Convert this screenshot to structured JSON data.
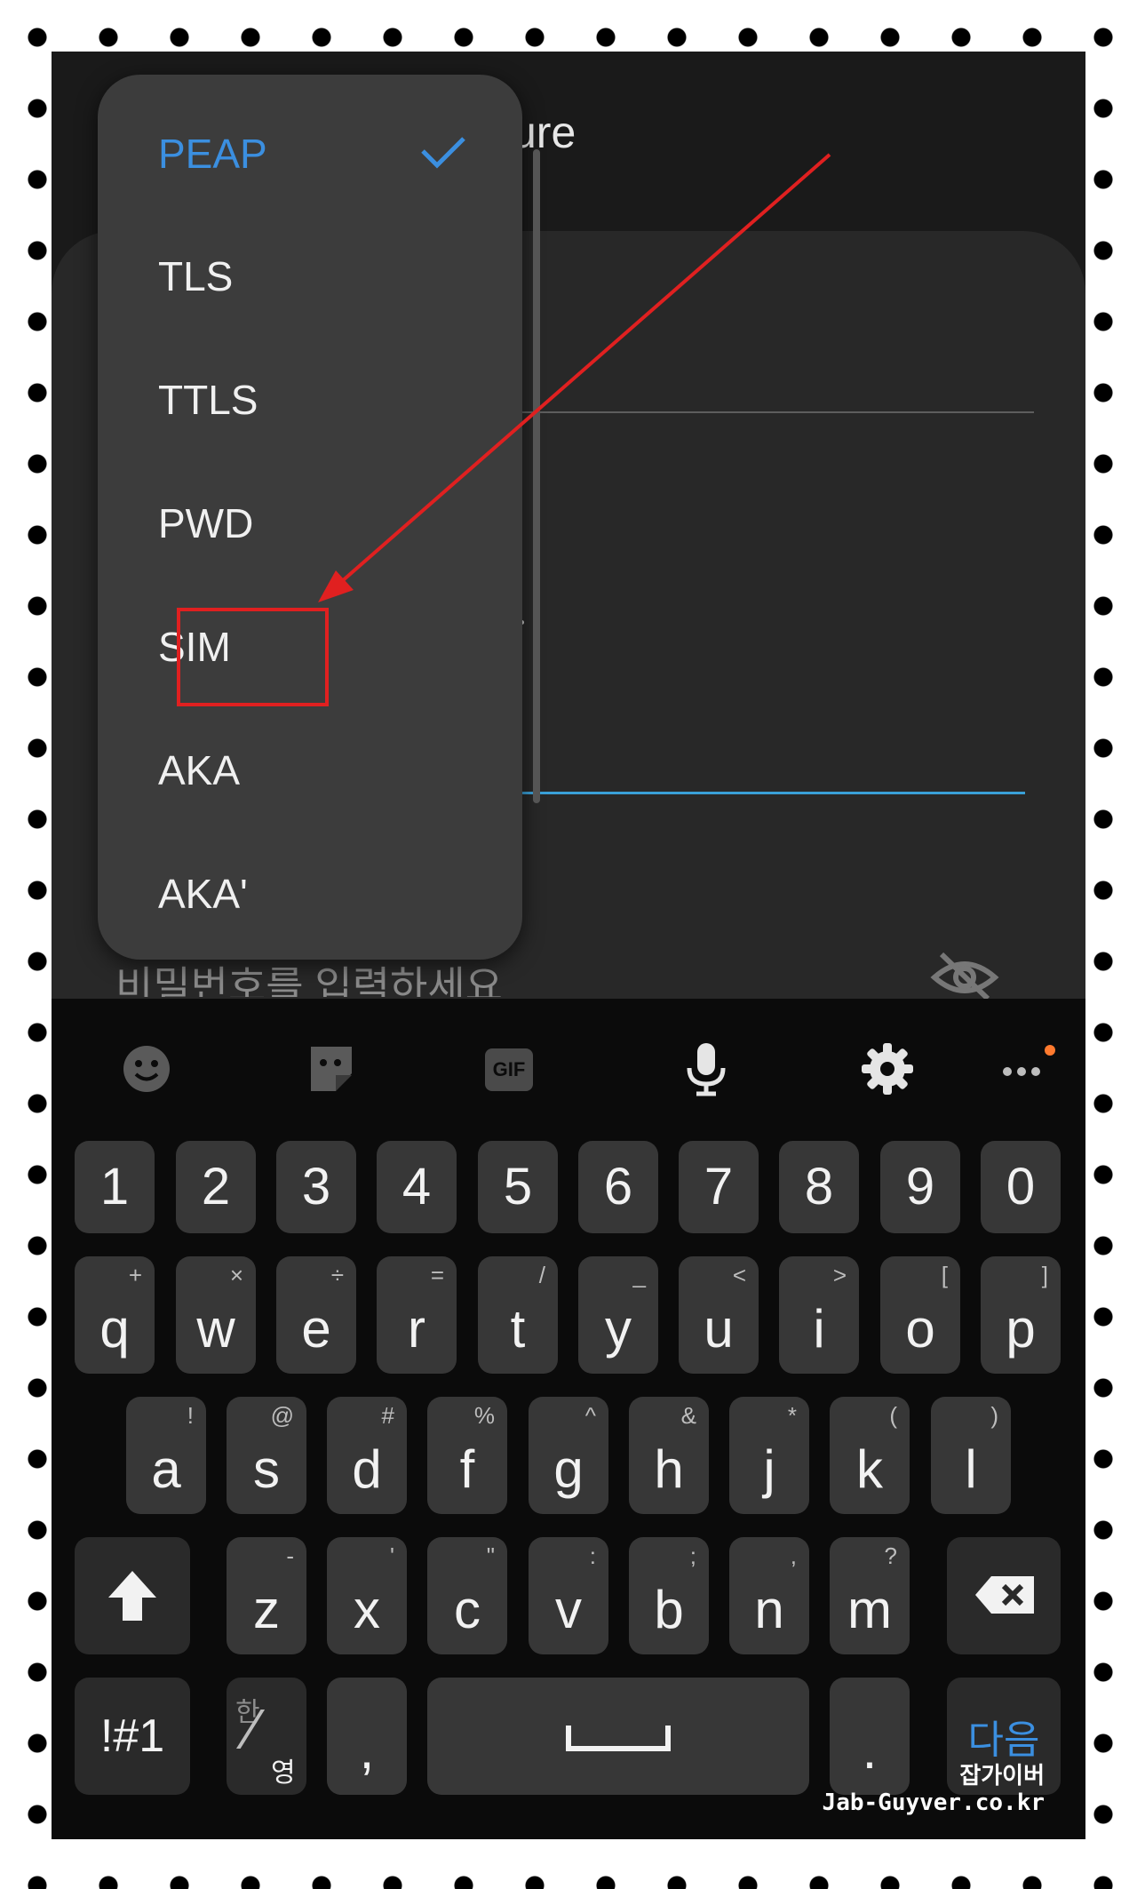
{
  "background": {
    "title_fragment": "ure",
    "password_placeholder": "비밀번호를 입력하세요"
  },
  "dropdown": {
    "items": [
      {
        "label": "PEAP",
        "selected": true
      },
      {
        "label": "TLS"
      },
      {
        "label": "TTLS"
      },
      {
        "label": "PWD"
      },
      {
        "label": "SIM",
        "highlighted": true
      },
      {
        "label": "AKA"
      },
      {
        "label": "AKA'"
      }
    ]
  },
  "keyboard": {
    "toolbar": [
      "emoji-icon",
      "sticker-icon",
      "gif-icon",
      "microphone-icon",
      "settings-icon",
      "more-icon"
    ],
    "gif_label": "GIF",
    "numbers": [
      "1",
      "2",
      "3",
      "4",
      "5",
      "6",
      "7",
      "8",
      "9",
      "0"
    ],
    "row1": [
      {
        "key": "q",
        "sub": "+"
      },
      {
        "key": "w",
        "sub": "×"
      },
      {
        "key": "e",
        "sub": "÷"
      },
      {
        "key": "r",
        "sub": "="
      },
      {
        "key": "t",
        "sub": "/"
      },
      {
        "key": "y",
        "sub": "_"
      },
      {
        "key": "u",
        "sub": "<"
      },
      {
        "key": "i",
        "sub": ">"
      },
      {
        "key": "o",
        "sub": "["
      },
      {
        "key": "p",
        "sub": "]"
      }
    ],
    "row2": [
      {
        "key": "a",
        "sub": "!"
      },
      {
        "key": "s",
        "sub": "@"
      },
      {
        "key": "d",
        "sub": "#"
      },
      {
        "key": "f",
        "sub": "%"
      },
      {
        "key": "g",
        "sub": "^"
      },
      {
        "key": "h",
        "sub": "&"
      },
      {
        "key": "j",
        "sub": "*"
      },
      {
        "key": "k",
        "sub": "("
      },
      {
        "key": "l",
        "sub": ")"
      }
    ],
    "row3": [
      {
        "key": "z",
        "sub": "-"
      },
      {
        "key": "x",
        "sub": "'"
      },
      {
        "key": "c",
        "sub": "\""
      },
      {
        "key": "v",
        "sub": ":"
      },
      {
        "key": "b",
        "sub": ";"
      },
      {
        "key": "n",
        "sub": ","
      },
      {
        "key": "m",
        "sub": "?"
      }
    ],
    "symbols_label": "!#1",
    "lang_top": "한",
    "lang_bottom": "영",
    "comma": ",",
    "period": ".",
    "next_label": "다음"
  },
  "watermark": {
    "line1": "잡가이버",
    "line2": "Jab-Guyver.co.kr"
  },
  "colors": {
    "accent": "#3b8fe0",
    "highlight": "#e02020",
    "focus_line": "#3aa0d8"
  }
}
